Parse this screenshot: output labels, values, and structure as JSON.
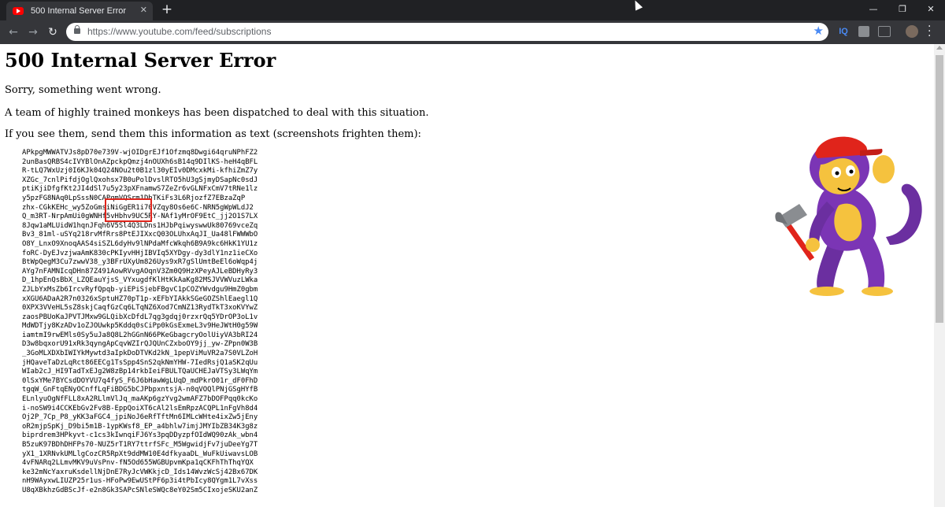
{
  "browser": {
    "tab": {
      "title": "500 Internal Server Error",
      "close_glyph": "✕"
    },
    "new_tab_glyph": "+",
    "window_controls": {
      "minimize": "—",
      "maximize": "❐",
      "close": "✕"
    },
    "nav": {
      "back": "←",
      "forward": "→",
      "reload": "↻"
    },
    "address_bar": {
      "url": "https://www.youtube.com/feed/subscriptions"
    },
    "extensions": {
      "iq_label": "IQ"
    }
  },
  "page": {
    "title": "500 Internal Server Error",
    "messages": [
      "Sorry, something went wrong.",
      "A team of highly trained monkeys has been dispatched to deal with this situation.",
      "If you see them, send them this information as text (screenshots frighten them):"
    ],
    "error_code": "APkpgMWWATVJs8pD70e739V-wjOIDgrEJf1Ofzmq8Dwgi64qruNPhFZ2\n2unBasQRBS4cIVYBlOnAZpckpQmzj4nOUXh6sB14q9DIlKS-heH4qBFL\nR-tLQ7WxUzj0I6KJk04Q24NOu2t0B1zl30yEIv0DMcxkMi-kfhiZmZ7y\nXZGc_7cnlPifdjOglQxohsx7B0uPolDvslRTO5hU3gSjmyDSapNc0sdJ\nptiKjiDfgfKt2JI4dSl7u5y23pXFnamwS7ZeZr6vGLNFxCmV7tRNe1lz\ny5pzFG8NAq0LpSssN0CAPqmVQSrm1DbTKiFs3L6RjozfZ7EBzaZqP\nzhx-CGkKEHc_wy5ZoGmsiNiGgER1i70VZqy8Os6e6C-NRN5gWpWLdJ2\nQ_m3RT-NrpAmUi0gWNHf5vHbhv9UC5RY-NAf1yMrOF9EtC_jj2O1S7LX\n8Jqw1aMLUidW1hqnJFqh6V5Sl4Q3LDns1HJbPqiwyswwUk80769vceZq\nBv3_81ml-uSYq218rvMfRrs8PtEJIXxcQ03OLUhxAqJI_Ua48lFWWWbO\nO8Y_LnxO9XnoqAAS4siSZL6dyHv9lNPdaMfcWkqh6B9A9kc6HkK1YU1z\nfoRC-DyEJvzjwaAmK830cPKIyvHHjIBVIq5XYDgy-dy3dlY1nz1ieCXo\nBtWpQegM3Cu7zwwV38_y3BFrUXyUm826Uys9xR7gSlUmtBeEl6oWqp4j\nAYg7nFAMNIcqDHn87Z491AowRVvgAOqnV3Zm0Q9HzXPeyAJLeBDHyRy3\nD_1hpEnQsBbX_LZQEauYjsS_VYxugdfKlHtKkAaKg82MSJVVWVuzLWka\nZJLbYxMsZb6IrcvRyfQpqb-yiEPiSjebFBgvC1pCOZYWvdgu9HmZ0gbm\nxXGU6ADaA2R7n0326xSptuHZ70pT1p-xEFbYIAkkSGeGOZShlEaegl1Q\n0XPX3VVeHL5sZ8skjCaqfGzCq6LTqNZ6Xod7CmNZ13RydTkT3xoKVYwZ\nzaosPBUoKaJPVTJMxw9GLQibXcDfdL7qg3gdqj0rzxrQq5YDrOP3oL1v\nMdWDTjy8KzADv1oZJOUwkp5Kddq0sCiPp0kGsExmeL3v9HeJWtH0g59W\niamtmI9rwEMls0Sy5uJa8Q8L2hGGnN66PKeGbagcryOolUiyVA3bRI24\nD3w8bqxorU91xRk3qyngApCqvWZIrQJQUnCZxboOY9jj_yw-ZPpn0W3B\n_3GoMLXDXbIWIYkMywtd3aIpkDoDTVKd2kN_1pepViMuVR2a7S0VLZoH\njHQaveTaDzLqRct86EECg1TsSpp4SnS2qkNmYHW-7IedRsjQ1aSK2qUu\nWIab2cJ_HI9TadTxEJg2W8zBp14rkbIeiFBULTQaUCHEJaVTSy3LWqYm\n0lSxYMe7BYCsdDOYVU7q4fyS_F6J6bHawWgLUqD_mdPkrO01r_dF0FhD\ntgqW_GnFtqENyOCnffLqFiBDG5bCJPbpxntsjA-n0qVOQlPNjGSgHYfB\nELnlyuOgNfFLL8xA2RLlmVlJq_maAKp6gzYvg2wmAFZ7bDOFPqq0kcKo\ni-noSW9i4CCKEbGv2Fv8B-EppQoiXT6cAl2lsEmRpzACQPL1nFgVh8d4\nOj2P_7Cp_P8_yKK3aFGC4_jpiNoJ6eRfTftMn6IMLcWHte4ixZw5jEny\noR2mjpSpKj_D9bi5m1B-1ypKWsf8_EP_a4bhlw7imjJMYIbZB34K3g8z\nbiprdrem3HPkyvt-c1cs3kIwnqiFJ6Ys3pqDDyzpfOIdWQ90zAk_wbn4\nB5zuK97BDhDHFPs70-NUZ5rT1RY7ttrfSFc_M5WgwidjFv7juDeeYg7T\nyX1_1XRNvkUMLlgCozCR5RpXt9ddMW10E4dfkyaaDL_WuFkUiwavsLOB\n4vFNARq2LLmvMKV9uVsPnv-fN5Od655WGBUpvmKpa1qCKFhThThqYQX\nke32mNcYaxruKsdellNjDnE7RyJcVWKkjcD_Ids14WvzWcSj42Bx67DK\nnH9WAyxwLIUZP25r1us-HFoPw9EwUStPF6p3i4tPbIcy8QYgm1L7vXss\nU8qXBkhzGdBScJf-e2n8Gk3SAPcSNleSWQc8eY02Sm5CIxojeSKU2anZ"
  }
}
